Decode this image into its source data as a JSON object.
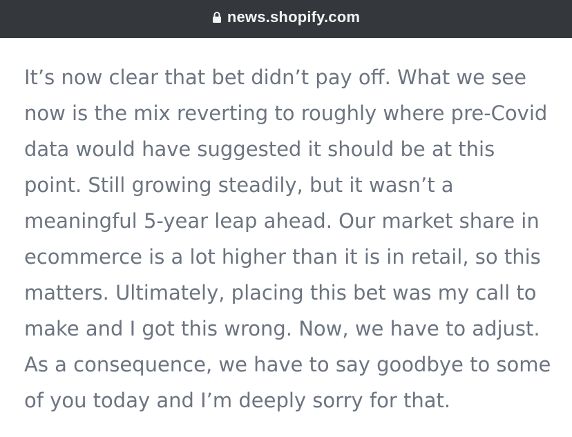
{
  "browser": {
    "url": "news.shopify.com",
    "lock_icon": "lock-icon"
  },
  "article": {
    "lines": [
      "It’s now clear that bet didn’t pay off. What we see",
      "now is the mix reverting to roughly where pre-Covid",
      "data would have suggested it should be at this",
      "point. Still growing steadily, but it wasn’t a",
      "meaningful 5-year leap ahead. Our market share in",
      "ecommerce is a lot higher than it is in retail, so this",
      "matters. Ultimately, placing this bet was my call to",
      "make and I got this wrong. Now, we have to adjust.",
      "As a consequence, we have to say goodbye to some",
      "of you today and I’m deeply sorry for that."
    ]
  },
  "colors": {
    "bar_bg": "#34383d",
    "url_text": "#f3f3f3",
    "body_text": "#6c7480"
  }
}
